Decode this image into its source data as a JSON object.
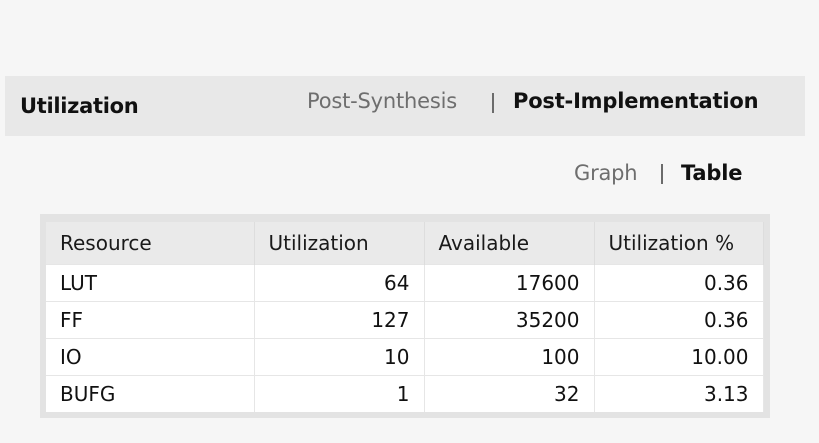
{
  "panel": {
    "title": "Utilization",
    "tabs": [
      {
        "label": "Post-Synthesis",
        "active": false
      },
      {
        "label": "Post-Implementation",
        "active": true
      }
    ]
  },
  "view_toggle": {
    "options": [
      {
        "label": "Graph",
        "active": false
      },
      {
        "label": "Table",
        "active": true
      }
    ]
  },
  "table": {
    "columns": [
      "Resource",
      "Utilization",
      "Available",
      "Utilization %"
    ],
    "rows": [
      {
        "resource": "LUT",
        "utilization": "64",
        "available": "17600",
        "percent": "0.36"
      },
      {
        "resource": "FF",
        "utilization": "127",
        "available": "35200",
        "percent": "0.36"
      },
      {
        "resource": "IO",
        "utilization": "10",
        "available": "100",
        "percent": "10.00"
      },
      {
        "resource": "BUFG",
        "utilization": "1",
        "available": "32",
        "percent": "3.13"
      }
    ]
  }
}
